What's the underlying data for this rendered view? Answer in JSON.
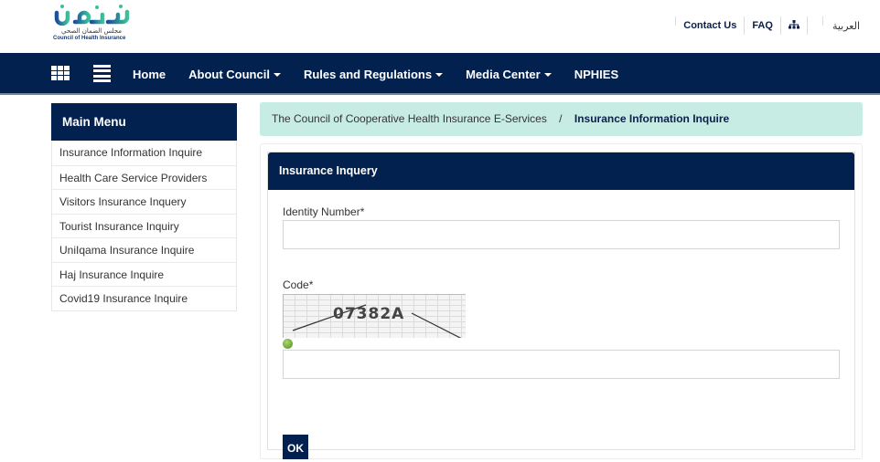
{
  "header": {
    "logo": {
      "arabic_name": "ضمان",
      "arabic_subtitle": "مجلس الضمان الصحي",
      "english_subtitle": "Council of Health Insurance",
      "brand_colors": {
        "green": "#3cc19a",
        "blue": "#1a4f9c"
      }
    },
    "links": {
      "contact": "Contact Us",
      "faq": "FAQ",
      "sitemap_icon": "sitemap-icon",
      "language": "العربية"
    }
  },
  "navbar": {
    "background": "#03214f",
    "icons": [
      "grid-icon",
      "menu-icon"
    ],
    "items": [
      {
        "label": "Home",
        "has_dropdown": false
      },
      {
        "label": "About Council",
        "has_dropdown": true
      },
      {
        "label": "Rules and Regulations",
        "has_dropdown": true
      },
      {
        "label": "Media Center",
        "has_dropdown": true
      },
      {
        "label": "NPHIES",
        "has_dropdown": false
      }
    ]
  },
  "sidebar": {
    "title": "Main Menu",
    "items": [
      {
        "label": "Insurance Information Inquire"
      },
      {
        "label": "Health Care Service Providers"
      },
      {
        "label": "Visitors Insurance Inquery"
      },
      {
        "label": "Tourist Insurance Inquiry"
      },
      {
        "label": "UniIqama Insurance Inquire"
      },
      {
        "label": "Haj Insurance Inquire"
      },
      {
        "label": "Covid19 Insurance Inquire"
      }
    ]
  },
  "breadcrumb": {
    "root": "The Council of Cooperative Health Insurance",
    "section": "E-Services",
    "separator": "/",
    "current": "Insurance Information Inquire",
    "background": "#c7ece4"
  },
  "form": {
    "title": "Insurance Inquery",
    "identity_label": "Identity Number*",
    "identity_value": "",
    "code_label": "Code*",
    "captcha_text": "07382A",
    "refresh_icon": "refresh-icon",
    "code_value": "",
    "submit_label": "OK"
  }
}
